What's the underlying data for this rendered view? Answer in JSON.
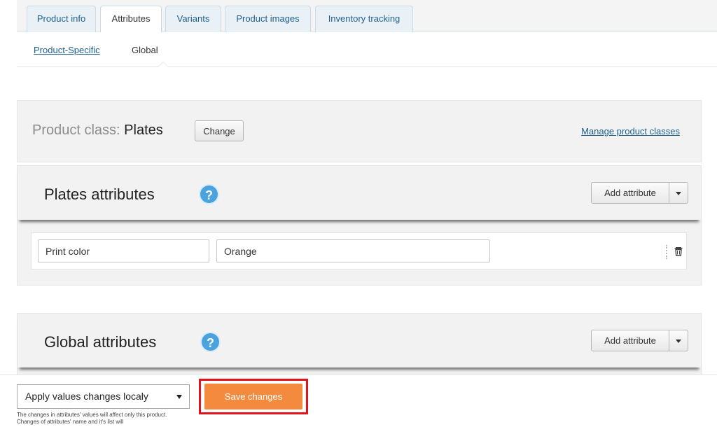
{
  "tabs": [
    {
      "label": "Product info",
      "active": false
    },
    {
      "label": "Attributes",
      "active": true
    },
    {
      "label": "Variants",
      "active": false
    },
    {
      "label": "Product images",
      "active": false
    },
    {
      "label": "Inventory tracking",
      "active": false
    }
  ],
  "subnav": {
    "product_specific": "Product-Specific",
    "global": "Global"
  },
  "product_class": {
    "label": "Product class:",
    "value": "Plates",
    "change_button": "Change",
    "manage_link": "Manage product classes"
  },
  "plates_section": {
    "title": "Plates attributes",
    "help_icon": "?",
    "add_button": "Add attribute",
    "rows": [
      {
        "name": "Print color",
        "value": "Orange"
      }
    ]
  },
  "global_section": {
    "title": "Global attributes",
    "help_icon": "?",
    "add_button": "Add attribute"
  },
  "footer": {
    "apply_select": "Apply values changes localy",
    "note": "The changes in attributes' values will affect only this product. Changes of attributes' name and it's list will",
    "save_button": "Save changes"
  },
  "colors": {
    "accent": "#f48a3e",
    "highlight": "#e4121b",
    "link": "#1f5f8b",
    "help": "#4aa3df"
  }
}
